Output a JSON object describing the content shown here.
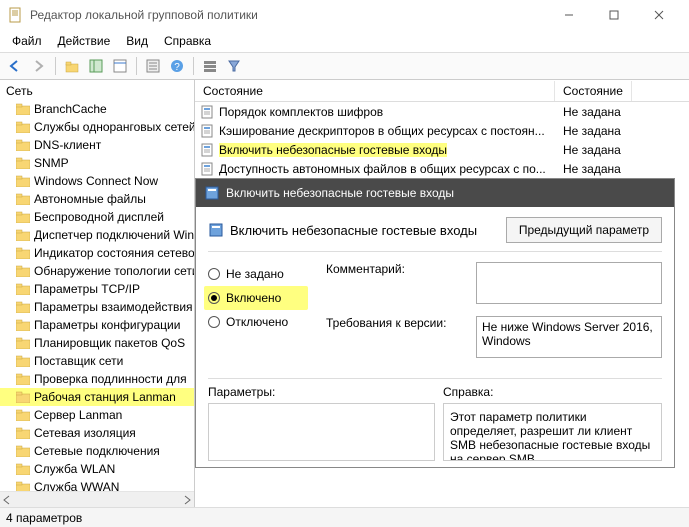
{
  "window": {
    "title": "Редактор локальной групповой политики"
  },
  "menus": {
    "file": "Файл",
    "action": "Действие",
    "view": "Вид",
    "help": "Справка"
  },
  "tree": {
    "root": "Сеть",
    "items": [
      "BranchCache",
      "Службы одноранговых сетей",
      "DNS-клиент",
      "SNMP",
      "Windows Connect Now",
      "Автономные файлы",
      "Беспроводной дисплей",
      "Диспетчер подключений Windows",
      "Индикатор состояния сетевого подключения",
      "Обнаружение топологии сети",
      "Параметры TCP/IP",
      "Параметры взаимодействия",
      "Параметры конфигурации",
      "Планировщик пакетов QoS",
      "Поставщик сети",
      "Проверка подлинности для",
      "Рабочая станция Lanman",
      "Сервер Lanman",
      "Сетевая изоляция",
      "Сетевые подключения",
      "Служба WLAN",
      "Служба WWAN"
    ],
    "selected_index": 16
  },
  "list": {
    "col1": "Состояние",
    "col2": "Состояние",
    "rows": [
      {
        "label": "Порядок комплектов шифров",
        "state": "Не задана"
      },
      {
        "label": "Кэширование дескрипторов в общих ресурсах с постоян...",
        "state": "Не задана"
      },
      {
        "label": "Включить небезопасные гостевые входы",
        "state": "Не задана"
      },
      {
        "label": "Доступность автономных файлов в общих ресурсах с по...",
        "state": "Не задана"
      }
    ],
    "highlighted_index": 2
  },
  "dialog": {
    "title": "Включить небезопасные гостевые входы",
    "heading": "Включить небезопасные гостевые входы",
    "prev_button": "Предыдущий параметр",
    "radios": {
      "not_configured": "Не задано",
      "enabled": "Включено",
      "disabled": "Отключено"
    },
    "comment_label": "Комментарий:",
    "requirements_label": "Требования к версии:",
    "requirements_value": "Не ниже Windows Server 2016, Windows",
    "params_label": "Параметры:",
    "help_label": "Справка:",
    "help_text": "Этот параметр политики определяет, разрешит ли клиент SMB небезопасные гостевые входы на сервер SMB.\n\nЕсли этот параметр политики включен..."
  },
  "statusbar": {
    "text": "4 параметров"
  }
}
